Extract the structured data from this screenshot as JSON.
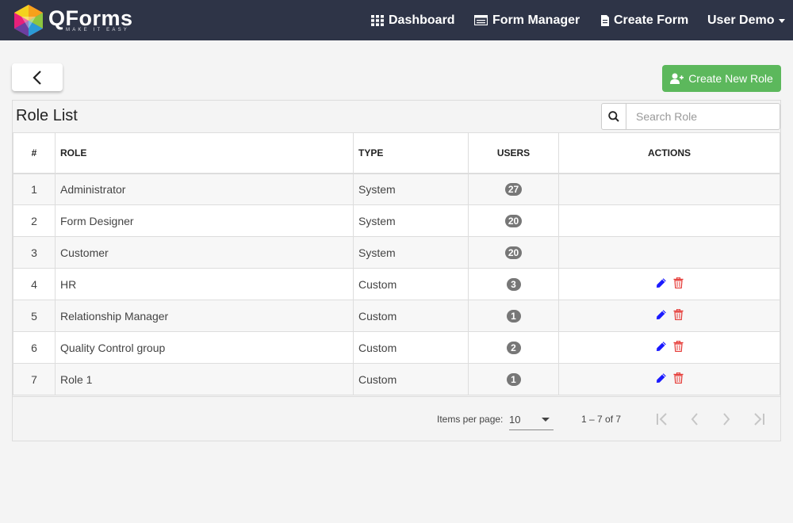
{
  "app": {
    "logo_name": "QForms",
    "logo_tagline": "MAKE IT EASY"
  },
  "nav": {
    "dashboard": "Dashboard",
    "form_manager": "Form Manager",
    "create_form": "Create Form",
    "user": "User Demo"
  },
  "toolbar": {
    "create_role": "Create New Role"
  },
  "panel": {
    "title": "Role List",
    "search_placeholder": "Search Role"
  },
  "table": {
    "headers": {
      "num": "#",
      "role": "ROLE",
      "type": "TYPE",
      "users": "USERS",
      "actions": "ACTIONS"
    },
    "rows": [
      {
        "num": "1",
        "role": "Administrator",
        "type": "System",
        "users": "27",
        "editable": false
      },
      {
        "num": "2",
        "role": "Form Designer",
        "type": "System",
        "users": "20",
        "editable": false
      },
      {
        "num": "3",
        "role": "Customer",
        "type": "System",
        "users": "20",
        "editable": false
      },
      {
        "num": "4",
        "role": "HR",
        "type": "Custom",
        "users": "3",
        "editable": true
      },
      {
        "num": "5",
        "role": "Relationship Manager",
        "type": "Custom",
        "users": "1",
        "editable": true
      },
      {
        "num": "6",
        "role": "Quality Control group",
        "type": "Custom",
        "users": "2",
        "editable": true
      },
      {
        "num": "7",
        "role": "Role 1",
        "type": "Custom",
        "users": "1",
        "editable": true
      }
    ]
  },
  "pager": {
    "items_per_page_label": "Items per page:",
    "items_per_page": "10",
    "range": "1 – 7 of 7"
  },
  "icons": {
    "edit": "pencil-icon",
    "delete": "trash-icon"
  },
  "colors": {
    "navbar": "#2e3447",
    "create_button": "#5cb85c",
    "badge": "#777777",
    "edit_icon": "#1a1aff",
    "delete_icon": "#e53935"
  }
}
